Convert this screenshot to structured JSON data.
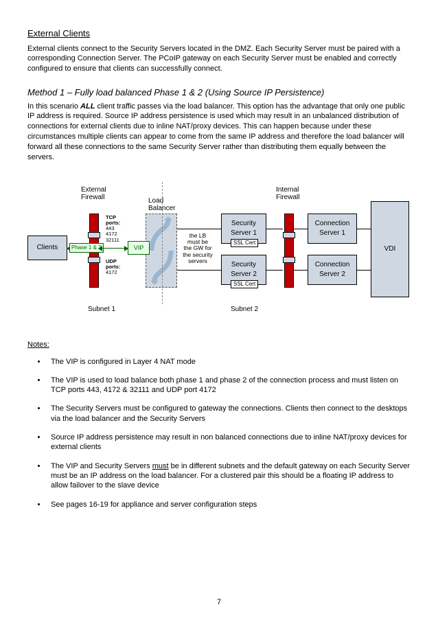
{
  "section_title": "External Clients",
  "section_para": "External clients connect to the Security Servers located in the DMZ. Each Security Server must be paired with a corresponding Connection Server. The PCoIP gateway on each Security Server must be enabled and correctly configured to ensure that clients can successfully connect.",
  "method_title": "Method 1 – Fully load balanced Phase 1 & 2 (Using Source IP Persistence)",
  "method_word_all": "ALL",
  "method_para_before": "In this scenario ",
  "method_para_after": " client traffic passes via the load balancer. This option has the advantage that only one public IP address is required. Source IP address persistence is used which may result in an unbalanced distribution of connections for external clients due to inline NAT/proxy devices. This can happen because under these circumstances multiple clients can appear to come from the same IP address and therefore the load balancer will forward all these connections to the same Security Server rather than distributing them equally between the servers.",
  "diagram": {
    "clients": "Clients",
    "external_firewall": "External\nFirewall",
    "load_balancer": "Load\nBalancer",
    "vip": "VIP",
    "phase_badge": "Phase 1 & 2",
    "tcp_label": "TCP\nports:\n443\n4172\n32111",
    "udp_label": "UDP\nports:\n4172",
    "lb_note": "the LB\nmust be\nthe GW for\nthe security\nservers",
    "sec1": "Security\nServer 1",
    "sec2": "Security\nServer 2",
    "ssl_cert": "SSL Cert",
    "internal_firewall": "Internal\nFirewall",
    "conn1": "Connection\nServer 1",
    "conn2": "Connection\nServer 2",
    "vdi": "VDI",
    "subnet1": "Subnet 1",
    "subnet2": "Subnet 2"
  },
  "notes_heading": "Notes:",
  "notes": [
    {
      "text": "The VIP is configured in Layer 4 NAT mode"
    },
    {
      "text": "The VIP is used to load balance both phase 1 and phase 2 of the connection process and must listen on TCP ports 443, 4172 & 32111 and UDP port 4172"
    },
    {
      "text": "The Security Servers must be configured to gateway the connections. Clients then connect to the desktops via the load balancer and the Security Servers"
    },
    {
      "text": "Source IP address persistence may result in non balanced connections due to inline NAT/proxy devices for external clients"
    },
    {
      "pre": "The VIP and Security Servers ",
      "u": "must",
      "post": " be in different subnets and the default gateway on each Security Server must be an IP address on the load balancer. For a clustered pair this should be a floating IP address to allow failover to the slave device"
    },
    {
      "text": "See pages 16-19 for appliance and server configuration steps"
    }
  ],
  "page_number": "7"
}
